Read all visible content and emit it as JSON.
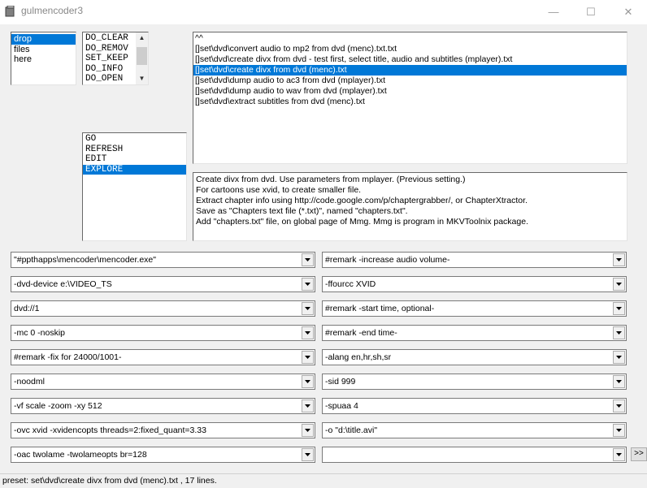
{
  "window": {
    "title": "gulmencoder3",
    "minimize": "—",
    "maximize": "☐",
    "close": "✕"
  },
  "drop_list": [
    "drop",
    "files",
    "here"
  ],
  "command_list": [
    "DO_CLEAR",
    "DO_REMOV",
    "SET_KEEP",
    "DO_INFO",
    "DO_OPEN"
  ],
  "action_list": [
    "GO",
    "REFRESH",
    "EDIT",
    "EXPLORE"
  ],
  "presets": [
    "^^",
    "[]set\\dvd\\convert audio to mp2 from dvd (menc).txt.txt",
    "[]set\\dvd\\create divx from dvd - test first, select title, audio and subtitles (mplayer).txt",
    "[]set\\dvd\\create divx from dvd (menc).txt",
    "[]set\\dvd\\dump audio to ac3 from dvd (mplayer).txt",
    "[]set\\dvd\\dump audio to wav from dvd (mplayer).txt",
    "[]set\\dvd\\extract subtitles from dvd (menc).txt"
  ],
  "description": [
    "Create divx from dvd. Use parameters from mplayer. (Previous setting.)",
    "For cartoons use xvid, to create smaller file.",
    "Extract chapter info using http://code.google.com/p/chaptergrabber/, or ChapterXtractor.",
    "Save as \"Chapters text file (*.txt)\", named \"chapters.txt\".",
    "Add \"chapters.txt\" file, on global page of Mmg. Mmg is program in MKVToolnix package."
  ],
  "left_params": [
    "\"#ppthapps\\mencoder\\mencoder.exe\"",
    "-dvd-device e:\\VIDEO_TS",
    "dvd://1",
    "-mc 0 -noskip",
    "#remark -fix for 24000/1001-",
    "-noodml",
    "-vf scale -zoom -xy 512",
    "-ovc xvid -xvidencopts threads=2:fixed_quant=3.33",
    "-oac twolame -twolameopts br=128"
  ],
  "right_params": [
    "#remark -increase audio volume-",
    "-ffourcc XVID",
    "#remark -start time, optional-",
    "#remark -end time-",
    "-alang en,hr,sh,sr",
    "-sid 999",
    "-spuaa 4",
    "-o \"d:\\title.avi\"",
    ""
  ],
  "more_button": ">>",
  "status": "preset: set\\dvd\\create divx from dvd (menc).txt , 17 lines.",
  "colors": {
    "selection": "#0078d7",
    "face": "#f0f0f0"
  }
}
